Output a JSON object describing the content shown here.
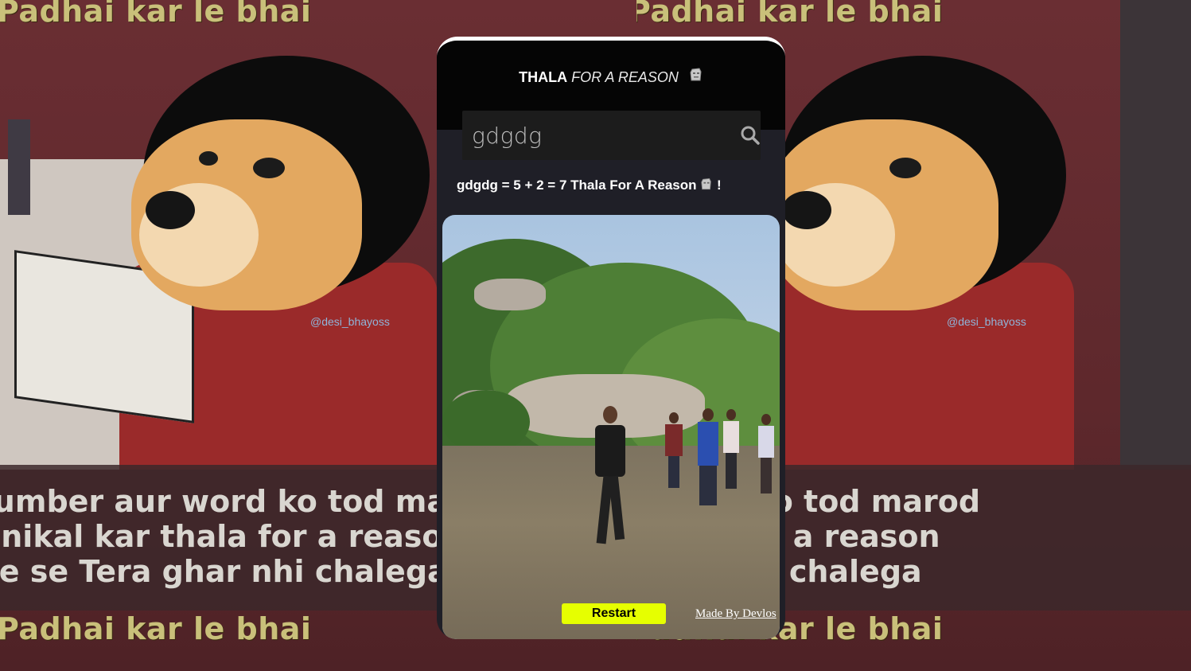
{
  "background": {
    "top_text": "Padhai kar le bhai",
    "bottom_text": "Padhai kar le bhai",
    "caption_lines": [
      "Number aur word ko tod marod",
      "ke nikal kar thala for a reason",
      "karne se Tera ghar nhi chalega"
    ],
    "watermark": "@desi_bhayoss"
  },
  "app": {
    "title_strong": "THALA",
    "title_rest": "FOR A REASON",
    "title_icon": "moai-icon",
    "search": {
      "value": "gdgdg",
      "placeholder": "",
      "icon": "search-icon"
    },
    "result_text": "gdgdg = 5 + 2 = 7 Thala For A Reason",
    "result_suffix": "!",
    "video": {
      "restart_label": "Restart",
      "credit_label": "Made By Devlos"
    }
  },
  "colors": {
    "accent": "#e6ff00",
    "card_bg": "#1f1f27",
    "header_bg": "#050505",
    "search_bg": "#1c1c1c"
  }
}
